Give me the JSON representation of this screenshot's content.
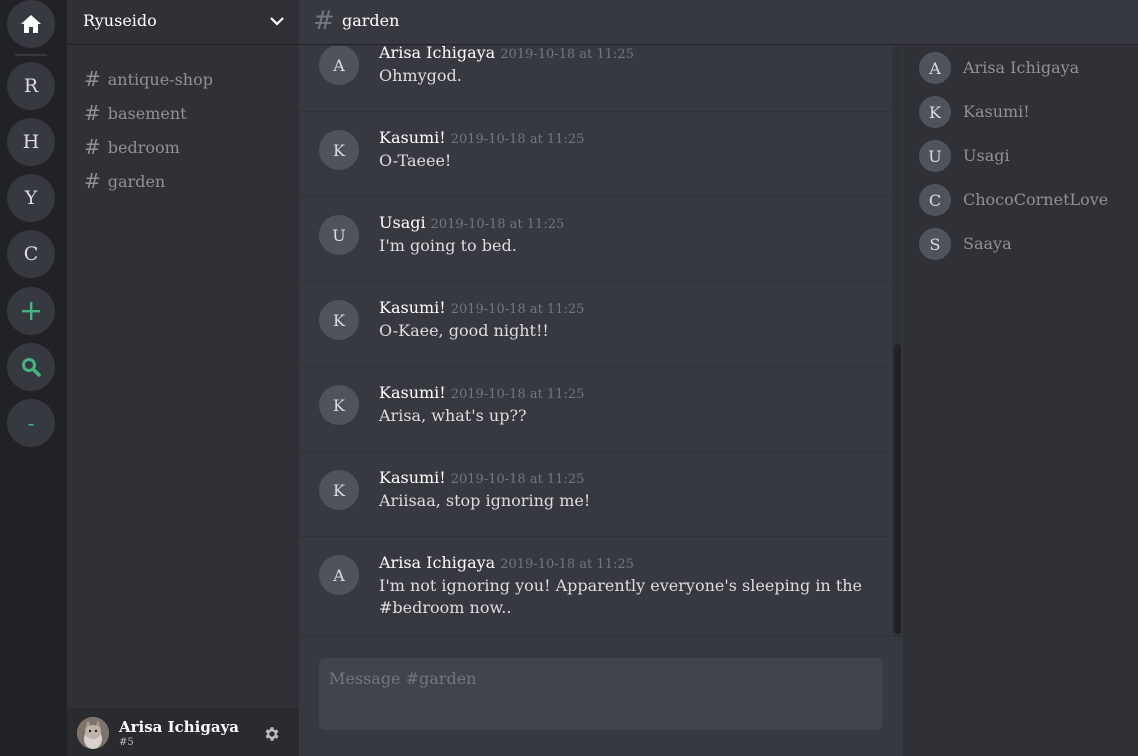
{
  "rail": {
    "home_icon": "home-icon",
    "servers": [
      "R",
      "H",
      "Y",
      "C"
    ],
    "add_label": "+",
    "search_icon": "search-icon",
    "minus_label": "-",
    "accent": "#43b581"
  },
  "sidebar": {
    "server_name": "Ryuseido",
    "channels": [
      {
        "hash": "#",
        "name": "antique-shop"
      },
      {
        "hash": "#",
        "name": "basement"
      },
      {
        "hash": "#",
        "name": "bedroom"
      },
      {
        "hash": "#",
        "name": "garden"
      }
    ],
    "user": {
      "name": "Arisa Ichigaya",
      "tag": "#5"
    }
  },
  "header": {
    "hash": "#",
    "title": "garden"
  },
  "messages": [
    {
      "initial": "A",
      "author": "Arisa Ichigaya",
      "timestamp": "2019-10-18 at 11:25",
      "text": "Ohmygod."
    },
    {
      "initial": "K",
      "author": "Kasumi!",
      "timestamp": "2019-10-18 at 11:25",
      "text": "O-Taeee!"
    },
    {
      "initial": "U",
      "author": "Usagi",
      "timestamp": "2019-10-18 at 11:25",
      "text": "I'm going to bed."
    },
    {
      "initial": "K",
      "author": "Kasumi!",
      "timestamp": "2019-10-18 at 11:25",
      "text": "O-Kaee, good night!!"
    },
    {
      "initial": "K",
      "author": "Kasumi!",
      "timestamp": "2019-10-18 at 11:25",
      "text": "Arisa, what's up??"
    },
    {
      "initial": "K",
      "author": "Kasumi!",
      "timestamp": "2019-10-18 at 11:25",
      "text": "Ariisaa, stop ignoring me!"
    },
    {
      "initial": "A",
      "author": "Arisa Ichigaya",
      "timestamp": "2019-10-18 at 11:25",
      "text": "I'm not ignoring you! Apparently everyone's sleeping in the #bedroom now.."
    }
  ],
  "composer": {
    "placeholder": "Message #garden"
  },
  "members": [
    {
      "initial": "A",
      "name": "Arisa Ichigaya"
    },
    {
      "initial": "K",
      "name": "Kasumi!"
    },
    {
      "initial": "U",
      "name": "Usagi"
    },
    {
      "initial": "C",
      "name": "ChocoCornetLove"
    },
    {
      "initial": "S",
      "name": "Saaya"
    }
  ]
}
